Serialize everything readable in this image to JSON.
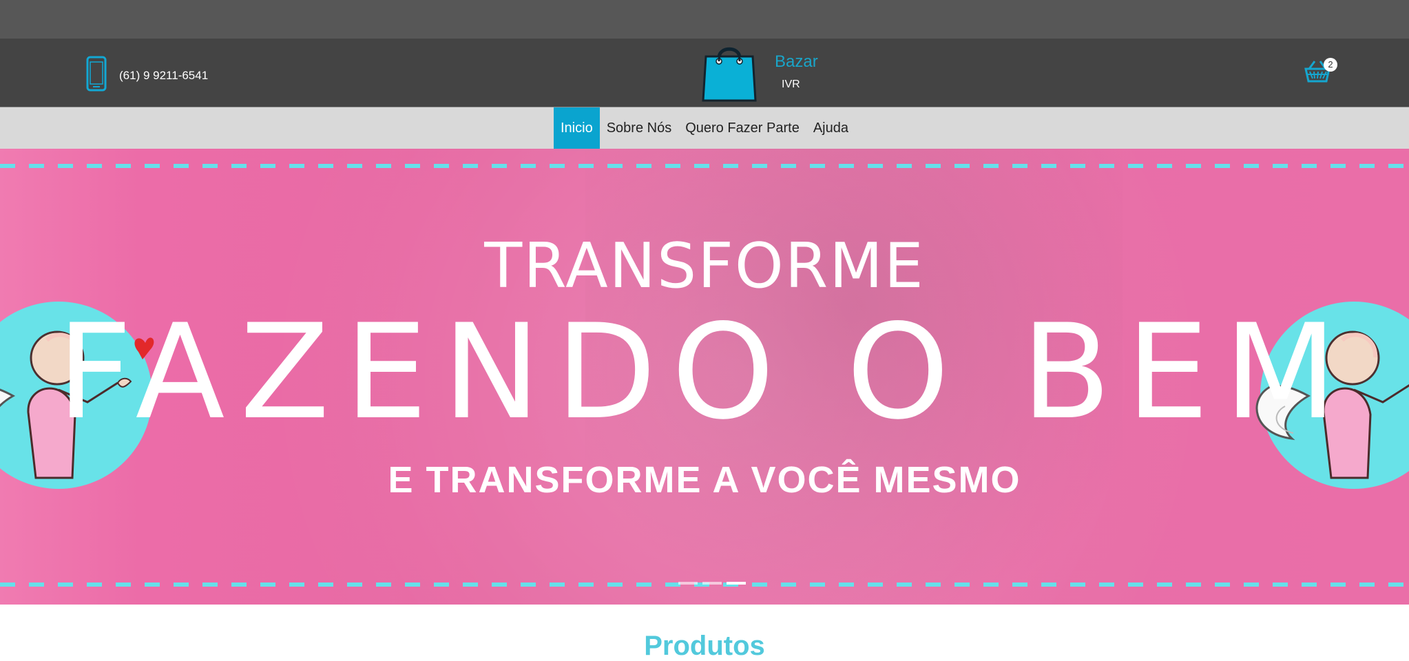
{
  "header": {
    "phone_number": "(61) 9 9211-6541",
    "logo_name": "Bazar",
    "logo_sub": "IVR",
    "cart_count": "2",
    "icons": {
      "phone": "phone-icon",
      "logo": "shopping-bag-icon",
      "cart": "basket-icon"
    }
  },
  "nav": {
    "items": [
      {
        "label": "Inicio",
        "active": true
      },
      {
        "label": "Sobre Nós",
        "active": false
      },
      {
        "label": "Quero Fazer Parte",
        "active": false
      },
      {
        "label": "Ajuda",
        "active": false
      }
    ]
  },
  "hero": {
    "title": "TRANSFORME",
    "main": "FAZENDO O BEM",
    "subtitle": "E TRANSFORME A VOCÊ MESMO",
    "active_slide": 3,
    "slides": 3
  },
  "section": {
    "title": "Produtos"
  },
  "colors": {
    "accent": "#0aa4cf",
    "hero_pink": "#e76aa5",
    "header_dark": "#444444",
    "top_strip": "#575757",
    "nav_bg": "#d9d9d9",
    "dashes": "#66e0ea"
  }
}
